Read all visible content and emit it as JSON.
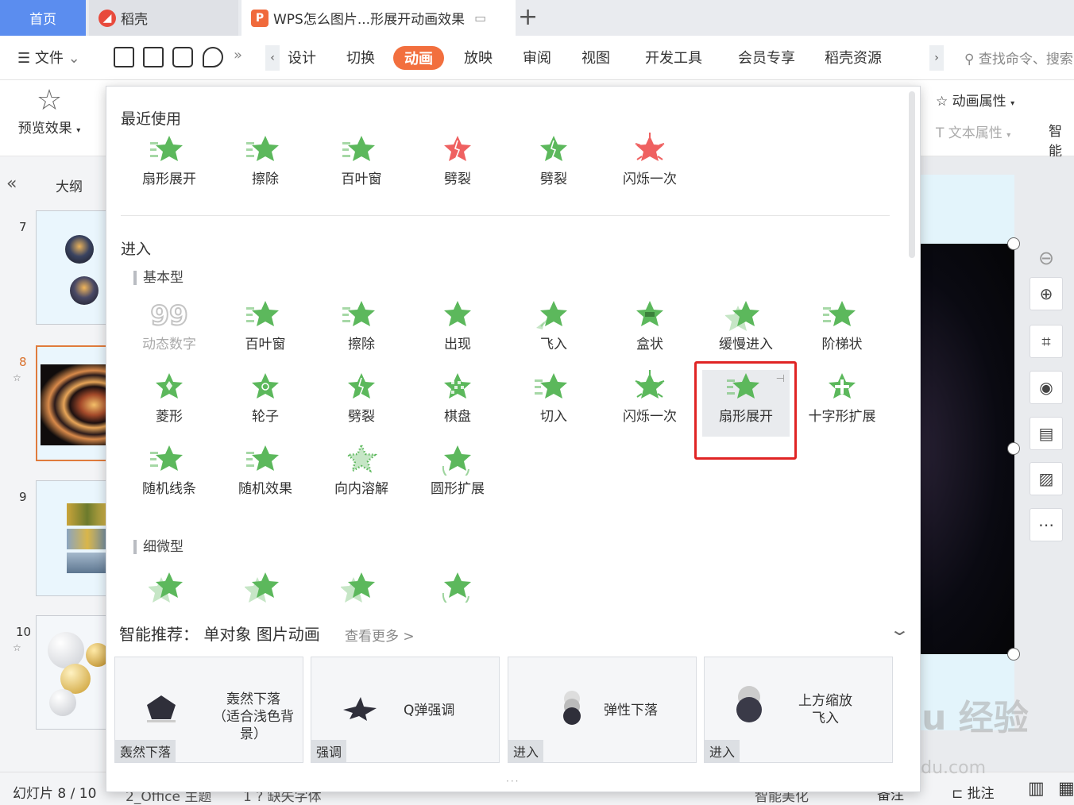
{
  "tabs": {
    "home": "首页",
    "docer": "稻壳",
    "doc": "WPS怎么图片...形展开动画效果"
  },
  "menu": {
    "file": "文件",
    "items": [
      "设计",
      "切换",
      "动画",
      "放映",
      "审阅",
      "视图",
      "开发工具",
      "会员专享",
      "稻壳资源"
    ],
    "active": "动画",
    "search_placeholder": "查找命令、搜索"
  },
  "ribbon": {
    "preview": "预览效果",
    "anim_props": "动画属性",
    "text_props": "文本属性",
    "smart": "智能"
  },
  "leftpanel": {
    "outline": "大纲",
    "slides": [
      "7",
      "8",
      "9",
      "10"
    ]
  },
  "popup": {
    "recent_title": "最近使用",
    "recent": [
      "扇形展开",
      "擦除",
      "百叶窗",
      "劈裂",
      "劈裂",
      "闪烁一次"
    ],
    "enter_title": "进入",
    "basic_title": "基本型",
    "basic": [
      "动态数字",
      "百叶窗",
      "擦除",
      "出现",
      "飞入",
      "盒状",
      "缓慢进入",
      "阶梯状",
      "菱形",
      "轮子",
      "劈裂",
      "棋盘",
      "切入",
      "闪烁一次",
      "扇形展开",
      "十字形扩展",
      "随机线条",
      "随机效果",
      "向内溶解",
      "圆形扩展"
    ],
    "subtle_title": "细微型",
    "smart_label": "智能推荐：",
    "smart_target": "单对象 图片动画",
    "smart_more": "查看更多 >",
    "cards": [
      {
        "text1": "轰然下落",
        "text2": "（适合浅色背景）",
        "tag": "轰然下落"
      },
      {
        "text1": "Q弹强调",
        "text2": "",
        "tag": "强调"
      },
      {
        "text1": "弹性下落",
        "text2": "",
        "tag": "进入"
      },
      {
        "text1": "上方缩放",
        "text2": "飞入",
        "tag": "进入"
      }
    ]
  },
  "statusbar": {
    "slide_info": "幻灯片 8 / 10",
    "theme": "2_Office 主题",
    "font_missing": "1 ? 缺失字体",
    "smart_beautify": "智能美化",
    "notes": "备注",
    "comments": "批注"
  },
  "watermark": {
    "main": "Bai du 经验",
    "sub": "jingyan.baidu.com"
  },
  "colors": {
    "accent": "#f26f3e",
    "home_tab": "#5b8def",
    "highlight": "#e02424",
    "anim_green": "#5cb85c",
    "anim_red": "#ef6161"
  }
}
